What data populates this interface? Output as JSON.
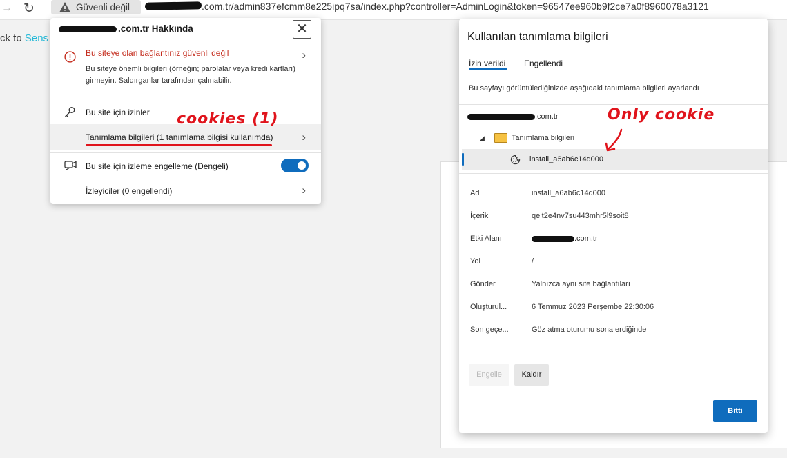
{
  "toolbar": {
    "forward_glyph": "→",
    "refresh_glyph": "↻",
    "security_label": "Güvenli değil",
    "url_visible": ".com.tr/admin837efcmm8e225ipq7sa/index.php?controller=AdminLogin&token=96547ee960b9f2ce7a0f8960078a3121"
  },
  "page": {
    "back_prefix": "ck to ",
    "back_link": "Sens"
  },
  "site_panel": {
    "title_suffix": ".com.tr Hakkında",
    "close_glyph": "✕",
    "warning_title": "Bu siteye olan bağlantınız güvenli değil",
    "warning_desc": "Bu siteye önemli bilgileri (örneğin; parolalar veya kredi kartları) girmeyin. Saldırganlar tarafından çalınabilir.",
    "permissions_label": "Bu site için izinler",
    "cookies_label": "Tanımlama bilgileri (1 tanımlama bilgisi kullanımda)",
    "tracking_label": "Bu site için izleme engelleme (Dengeli)",
    "trackers_label": "İzleyiciler (0 engellendi)",
    "chevron_glyph": "›",
    "tracking_toggle_on": true
  },
  "annotations": {
    "cookies_note": "cookies (1)",
    "only_cookie_note": "Only cookie"
  },
  "cookie_dialog": {
    "title": "Kullanılan tanımlama bilgileri",
    "tabs": [
      {
        "label": "İzin verildi",
        "active": true
      },
      {
        "label": "Engellendi",
        "active": false
      }
    ],
    "description": "Bu sayfayı görüntülediğinizde aşağıdaki tanımlama bilgileri ayarlandı",
    "tree": {
      "domain_suffix": ".com.tr",
      "folder_label": "Tanımlama bilgileri",
      "cookie_name": "install_a6ab6c14d000"
    },
    "details": [
      {
        "label": "Ad",
        "value": "install_a6ab6c14d000"
      },
      {
        "label": "İçerik",
        "value": "qelt2e4nv7su443mhr5l9soit8"
      },
      {
        "label": "Etki Alanı",
        "value": ".com.tr"
      },
      {
        "label": "Yol",
        "value": "/"
      },
      {
        "label": "Gönder",
        "value": "Yalnızca aynı site bağlantıları"
      },
      {
        "label": "Oluşturul...",
        "value": "6 Temmuz 2023 Perşembe 22:30:06"
      },
      {
        "label": "Son geçe...",
        "value": "Göz atma oturumu sona erdiğinde"
      }
    ],
    "buttons": {
      "block": "Engelle",
      "remove": "Kaldır",
      "done": "Bitti"
    }
  },
  "colors": {
    "accent": "#0f6cbd",
    "warning": "#c42b1c",
    "annotation": "#e0141c",
    "link": "#25b9d7"
  }
}
